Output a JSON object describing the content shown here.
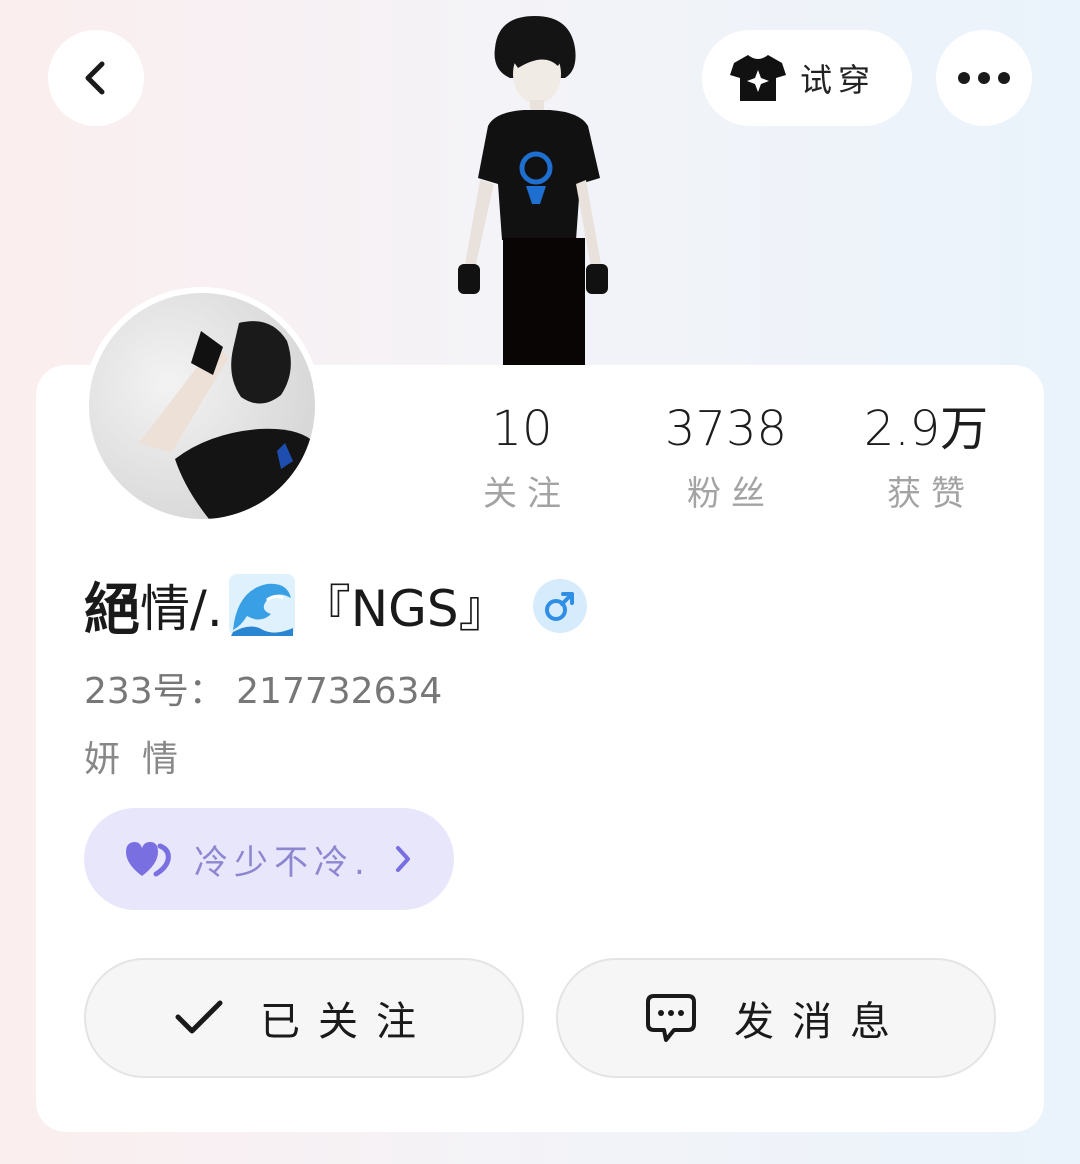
{
  "header": {
    "try_on_label": "试穿",
    "back_icon": "chevron-left-icon",
    "try_on_icon": "tshirt-star-icon",
    "more_icon": "more-dots-icon"
  },
  "stats": [
    {
      "value": "10",
      "label": "关注"
    },
    {
      "value": "3738",
      "label": "粉丝"
    },
    {
      "value": "2.9万",
      "label": "获赞"
    }
  ],
  "profile": {
    "name_part1": "絕",
    "name_part2": "情/.",
    "name_part3": "『NGS』",
    "gender_icon": "male-icon",
    "uid": "233号： 217732634",
    "bio": "妍情"
  },
  "cp": {
    "text": "冷少不冷.",
    "icon": "purple-heart-icon"
  },
  "actions": {
    "follow_label": "已关注",
    "message_label": "发消息"
  },
  "colors": {
    "accent_purple": "#7a6fe0",
    "gender_blue": "#2f8ee5",
    "pill_bg": "#e8e6fa"
  }
}
